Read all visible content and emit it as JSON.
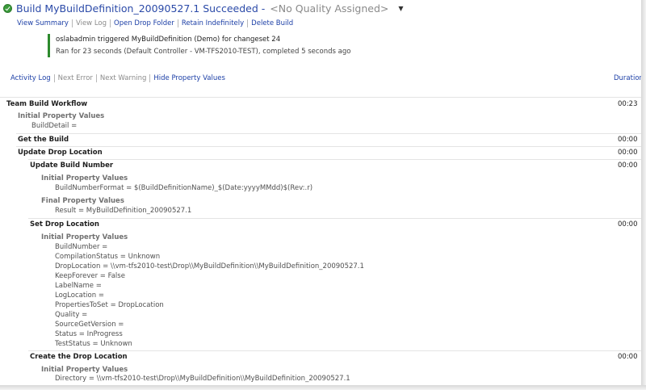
{
  "header": {
    "title": "Build MyBuildDefinition_20090527.1 Succeeded",
    "dash": "-",
    "quality": "<No Quality Assigned>",
    "quality_dropdown": "▼"
  },
  "links": [
    {
      "label": "View Summary",
      "enabled": true
    },
    {
      "label": "View Log",
      "enabled": false
    },
    {
      "label": "Open Drop Folder",
      "enabled": true
    },
    {
      "label": "Retain Indefinitely",
      "enabled": true
    },
    {
      "label": "Delete Build",
      "enabled": true
    }
  ],
  "summary": {
    "triggered": "oslabadmin triggered MyBuildDefinition (Demo) for changeset 24",
    "ran": "Ran for 23 seconds (Default Controller - VM-TFS2010-TEST), completed 5 seconds ago"
  },
  "tabs": [
    {
      "label": "Activity Log",
      "enabled": true
    },
    {
      "label": "Next Error",
      "enabled": false
    },
    {
      "label": "Next Warning",
      "enabled": false
    },
    {
      "label": "Hide Property Values",
      "enabled": true
    }
  ],
  "duration_label": "Duration",
  "log": {
    "team_build_workflow": "Team Build Workflow",
    "team_build_workflow_dur": "00:23",
    "initial_property_values": "Initial Property Values",
    "final_property_values": "Final Property Values",
    "build_detail": "BuildDetail =",
    "get_the_build": "Get the Build",
    "get_the_build_dur": "00:00",
    "update_drop_location": "Update Drop Location",
    "update_drop_location_dur": "00:00",
    "update_build_number": "Update Build Number",
    "update_build_number_dur": "00:00",
    "build_number_format": "BuildNumberFormat = $(BuildDefinitionName)_$(Date:yyyyMMdd)$(Rev:.r)",
    "result": "Result = MyBuildDefinition_20090527.1",
    "set_drop_location": "Set Drop Location",
    "set_drop_location_dur": "00:00",
    "set_drop_props": [
      "BuildNumber =",
      "CompilationStatus = Unknown",
      "DropLocation = \\\\vm-tfs2010-test\\Drop\\\\MyBuildDefinition\\\\MyBuildDefinition_20090527.1",
      "KeepForever = False",
      "LabelName =",
      "LogLocation =",
      "PropertiesToSet = DropLocation",
      "Quality =",
      "SourceGetVersion =",
      "Status = InProgress",
      "TestStatus = Unknown"
    ],
    "create_drop_location": "Create the Drop Location",
    "create_drop_location_dur": "00:00",
    "directory": "Directory = \\\\vm-tfs2010-test\\Drop\\\\MyBuildDefinition\\\\MyBuildDefinition_20090527.1"
  }
}
